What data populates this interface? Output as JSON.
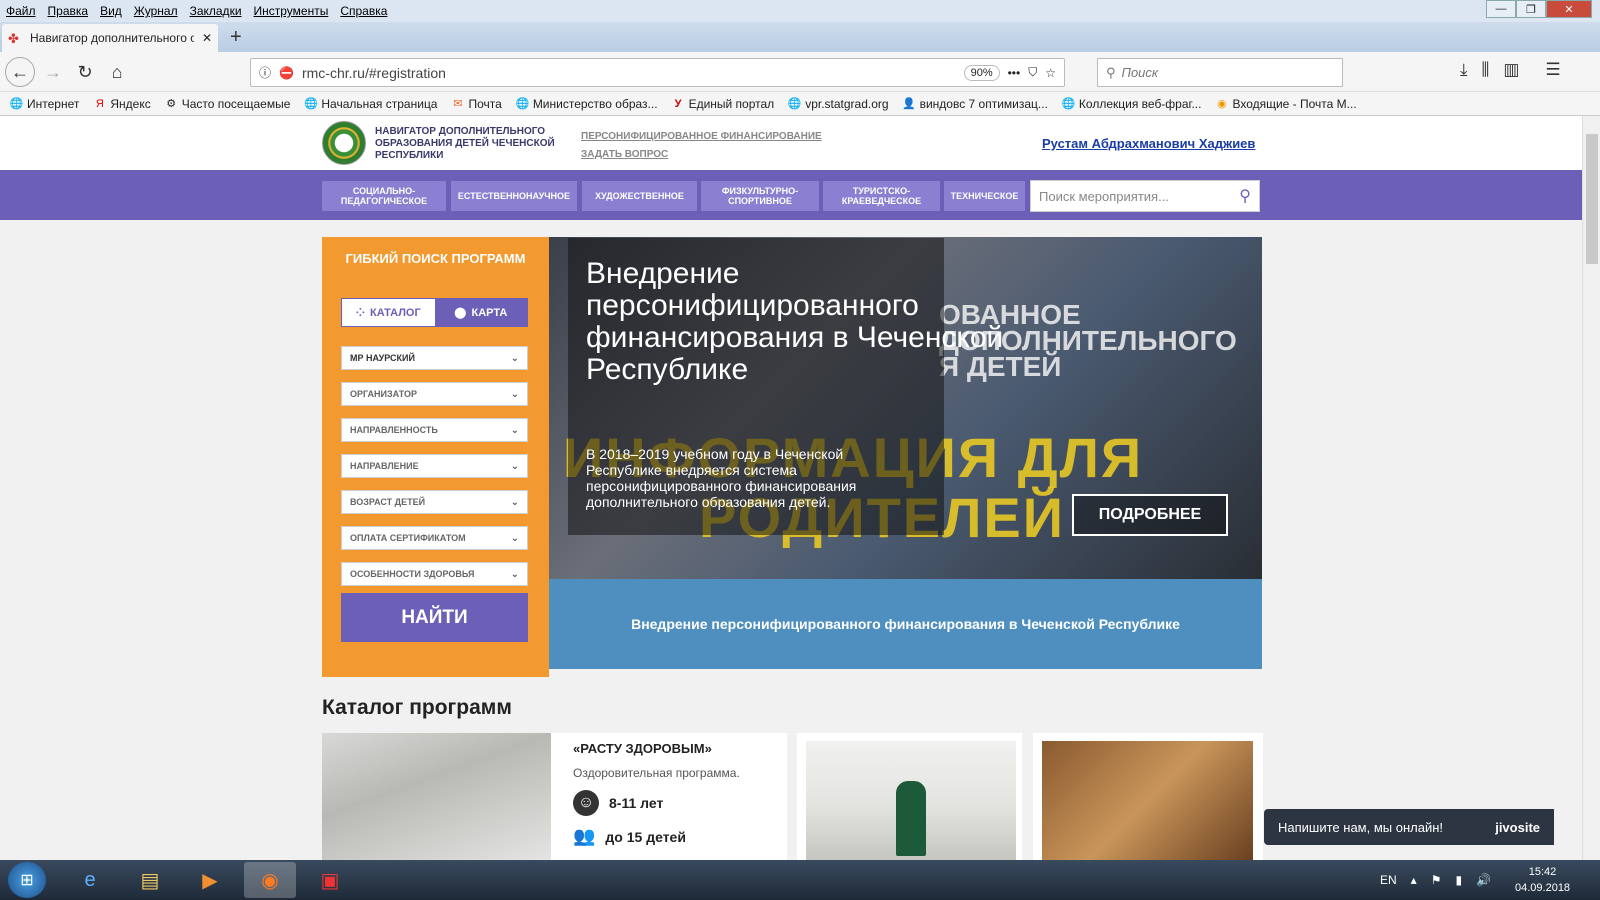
{
  "menubar": {
    "items": [
      "Файл",
      "Правка",
      "Вид",
      "Журнал",
      "Закладки",
      "Инструменты",
      "Справка"
    ]
  },
  "tab": {
    "title": "Навигатор дополнительного о"
  },
  "urlbar": {
    "url": "rmc-chr.ru/#registration",
    "zoom": "90%"
  },
  "searchbar": {
    "placeholder": "Поиск"
  },
  "bookmarks": [
    {
      "label": "Интернет",
      "icon": "globe-icon"
    },
    {
      "label": "Яндекс",
      "icon": "yandex-icon"
    },
    {
      "label": "Часто посещаемые",
      "icon": "gear-icon"
    },
    {
      "label": "Начальная страница",
      "icon": "globe-icon"
    },
    {
      "label": "Почта",
      "icon": "mail-icon"
    },
    {
      "label": "Министерство образ...",
      "icon": "globe-icon"
    },
    {
      "label": "Единый портал",
      "icon": "portal-icon"
    },
    {
      "label": "vpr.statgrad.org",
      "icon": "globe-icon"
    },
    {
      "label": "виндовс 7 оптимизац...",
      "icon": "user-icon"
    },
    {
      "label": "Коллекция веб-фраг...",
      "icon": "globe-icon"
    },
    {
      "label": "Входящие - Почта М...",
      "icon": "mail-icon"
    }
  ],
  "header": {
    "logo_text": "НАВИГАТОР ДОПОЛНИТЕЛЬНОГО ОБРАЗОВАНИЯ ДЕТЕЙ ЧЕЧЕНСКОЙ РЕСПУБЛИКИ",
    "link1": "ПЕРСОНИФИЦИРОВАННОЕ ФИНАНСИРОВАНИЕ",
    "link2": "ЗАДАТЬ ВОПРОС",
    "user": "Рустам Абдрахманович Хаджиев"
  },
  "categories": [
    "СОЦИАЛЬНО-ПЕДАГОГИЧЕСКОЕ",
    "ЕСТЕСТВЕННОНАУЧНОЕ",
    "ХУДОЖЕСТВЕННОЕ",
    "ФИЗКУЛЬТУРНО-СПОРТИВНОЕ",
    "ТУРИСТСКО-КРАЕВЕДЧЕСКОЕ",
    "ТЕХНИЧЕСКОЕ"
  ],
  "event_search": {
    "placeholder": "Поиск мероприятия..."
  },
  "sidebar": {
    "title": "ГИБКИЙ ПОИСК ПРОГРАММ",
    "tab_catalog": "КАТАЛОГ",
    "tab_map": "КАРТА",
    "filters": [
      "МР НАУРСКИЙ",
      "ОРГАНИЗАТОР",
      "НАПРАВЛЕННОСТЬ",
      "НАПРАВЛЕНИЕ",
      "ВОЗРАСТ ДЕТЕЙ",
      "ОПЛАТА СЕРТИФИКАТОМ",
      "ОСОБЕННОСТИ ЗДОРОВЬЯ"
    ],
    "find_label": "НАЙТИ"
  },
  "slide": {
    "title": "Внедрение персонифицированного финансирования в Чеченской Республике",
    "text": "В 2018–2019 учебном году в Чеченской Республике внедряется система персонифицированного финансирования дополнительного образования детей.",
    "more_label": "ПОДРОБНЕЕ",
    "bg_line1": "ИНФОРМАЦИЯ ДЛЯ",
    "bg_line2": "РОДИТЕЛЕЙ",
    "bg_line3": "ОВАННОЕ",
    "bg_line4": "ДОПОЛНИТЕЛЬНОГО",
    "bg_line5": "Я ДЕТЕЙ",
    "caption": "Внедрение персонифицированного финансирования в Чеченской Республике"
  },
  "catalog": {
    "title": "Каталог программ",
    "card1": {
      "title": "«РАСТУ ЗДОРОВЫМ»",
      "desc": "Оздоровительная программа.",
      "age": "8-11 лет",
      "count": "до 15 детей"
    }
  },
  "jivo": {
    "text": "Напишите нам, мы онлайн!",
    "brand": "jivosite"
  },
  "taskbar": {
    "lang": "EN",
    "time": "15:42",
    "date": "04.09.2018"
  }
}
